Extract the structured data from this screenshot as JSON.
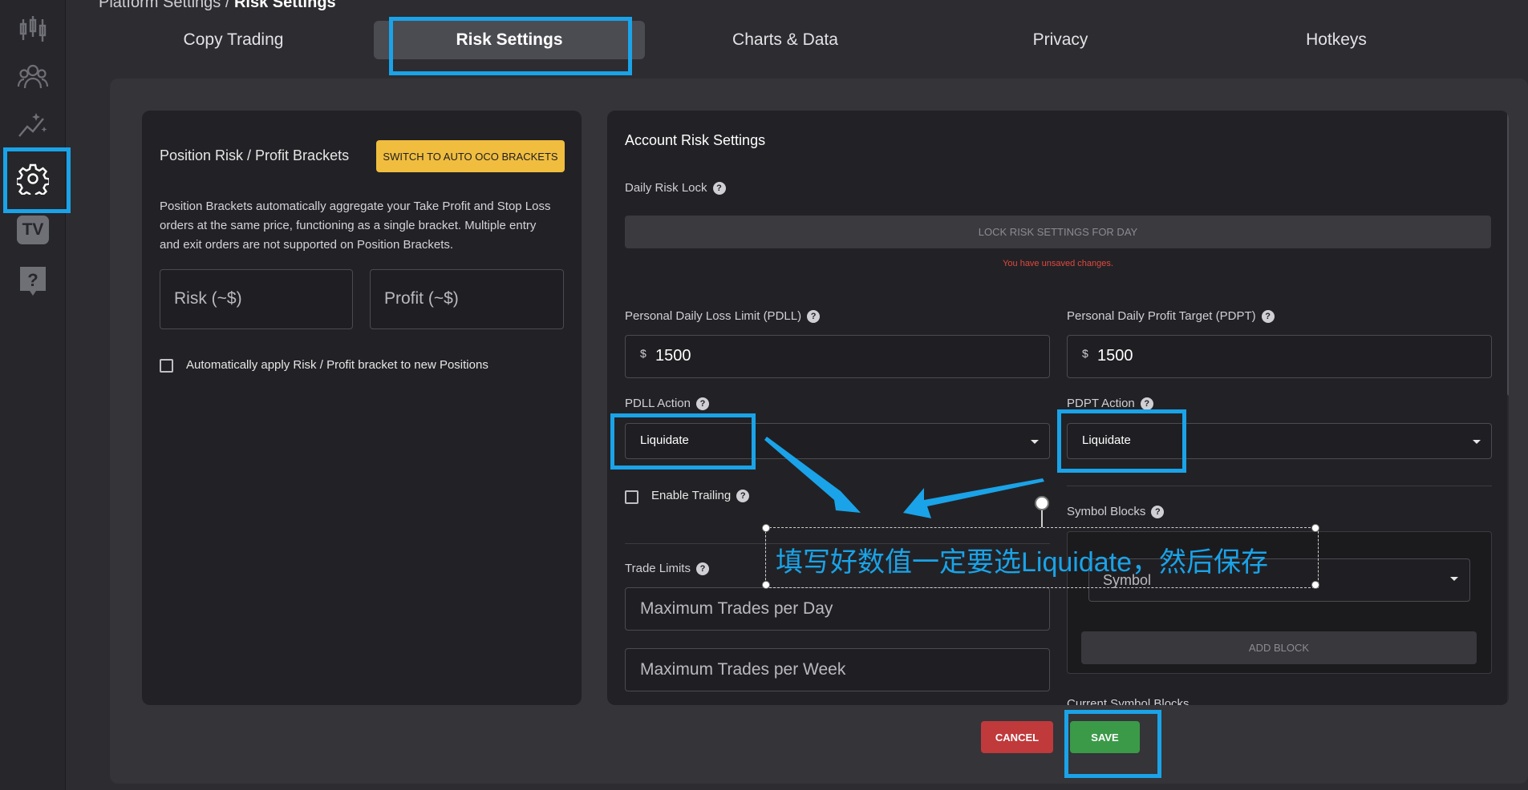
{
  "breadcrumb": {
    "root": "Platform Settings / ",
    "current": "Risk Settings"
  },
  "tabs": [
    {
      "label": "Copy Trading"
    },
    {
      "label": "Risk Settings"
    },
    {
      "label": "Charts & Data"
    },
    {
      "label": "Privacy"
    },
    {
      "label": "Hotkeys"
    }
  ],
  "sidebar": {
    "icons": [
      "candlestick-chart-icon",
      "users-icon",
      "sparkle-chart-icon",
      "gear-icon",
      "tv-icon",
      "help-chat-icon"
    ],
    "tv_label": "TV"
  },
  "position_panel": {
    "title": "Position Risk / Profit Brackets",
    "switch_button": "SWITCH TO AUTO OCO BRACKETS",
    "description": "Position Brackets automatically aggregate your Take Profit and Stop Loss orders at the same price, functioning as a single bracket. Multiple entry and exit orders are not supported on Position Brackets.",
    "risk_placeholder": "Risk (~$)",
    "profit_placeholder": "Profit (~$)",
    "auto_apply_label": "Automatically apply Risk / Profit bracket to new Positions"
  },
  "account_panel": {
    "title": "Account Risk Settings",
    "daily_risk_lock_label": "Daily Risk Lock",
    "lock_button": "LOCK RISK SETTINGS FOR DAY",
    "unsaved_message": "You have unsaved changes.",
    "pdll_label": "Personal Daily Loss Limit (PDLL)",
    "pdll_currency": "$",
    "pdll_value": "1500",
    "pdpt_label": "Personal Daily Profit Target (PDPT)",
    "pdpt_currency": "$",
    "pdpt_value": "1500",
    "pdll_action_label": "PDLL Action",
    "pdll_action_value": "Liquidate",
    "pdpt_action_label": "PDPT Action",
    "pdpt_action_value": "Liquidate",
    "enable_trailing_label": "Enable Trailing",
    "symbol_blocks_label": "Symbol Blocks",
    "symbol_placeholder": "Symbol",
    "add_block_button": "ADD BLOCK",
    "trade_limits_label": "Trade Limits",
    "max_trades_day_placeholder": "Maximum Trades per Day",
    "max_trades_week_placeholder": "Maximum Trades per Week",
    "cutoff_label": "Current Symbol Blocks"
  },
  "footer": {
    "cancel": "CANCEL",
    "save": "SAVE"
  },
  "annotation": {
    "text": "填写好数值一定要选Liquidate，然后保存",
    "color": "#1aa3e8"
  },
  "colors": {
    "accent_yellow": "#f0bd3f",
    "cancel_red": "#c0393b",
    "save_green": "#3b9a48",
    "highlight_blue": "#1aa3e8",
    "error_red": "#e0483e"
  }
}
